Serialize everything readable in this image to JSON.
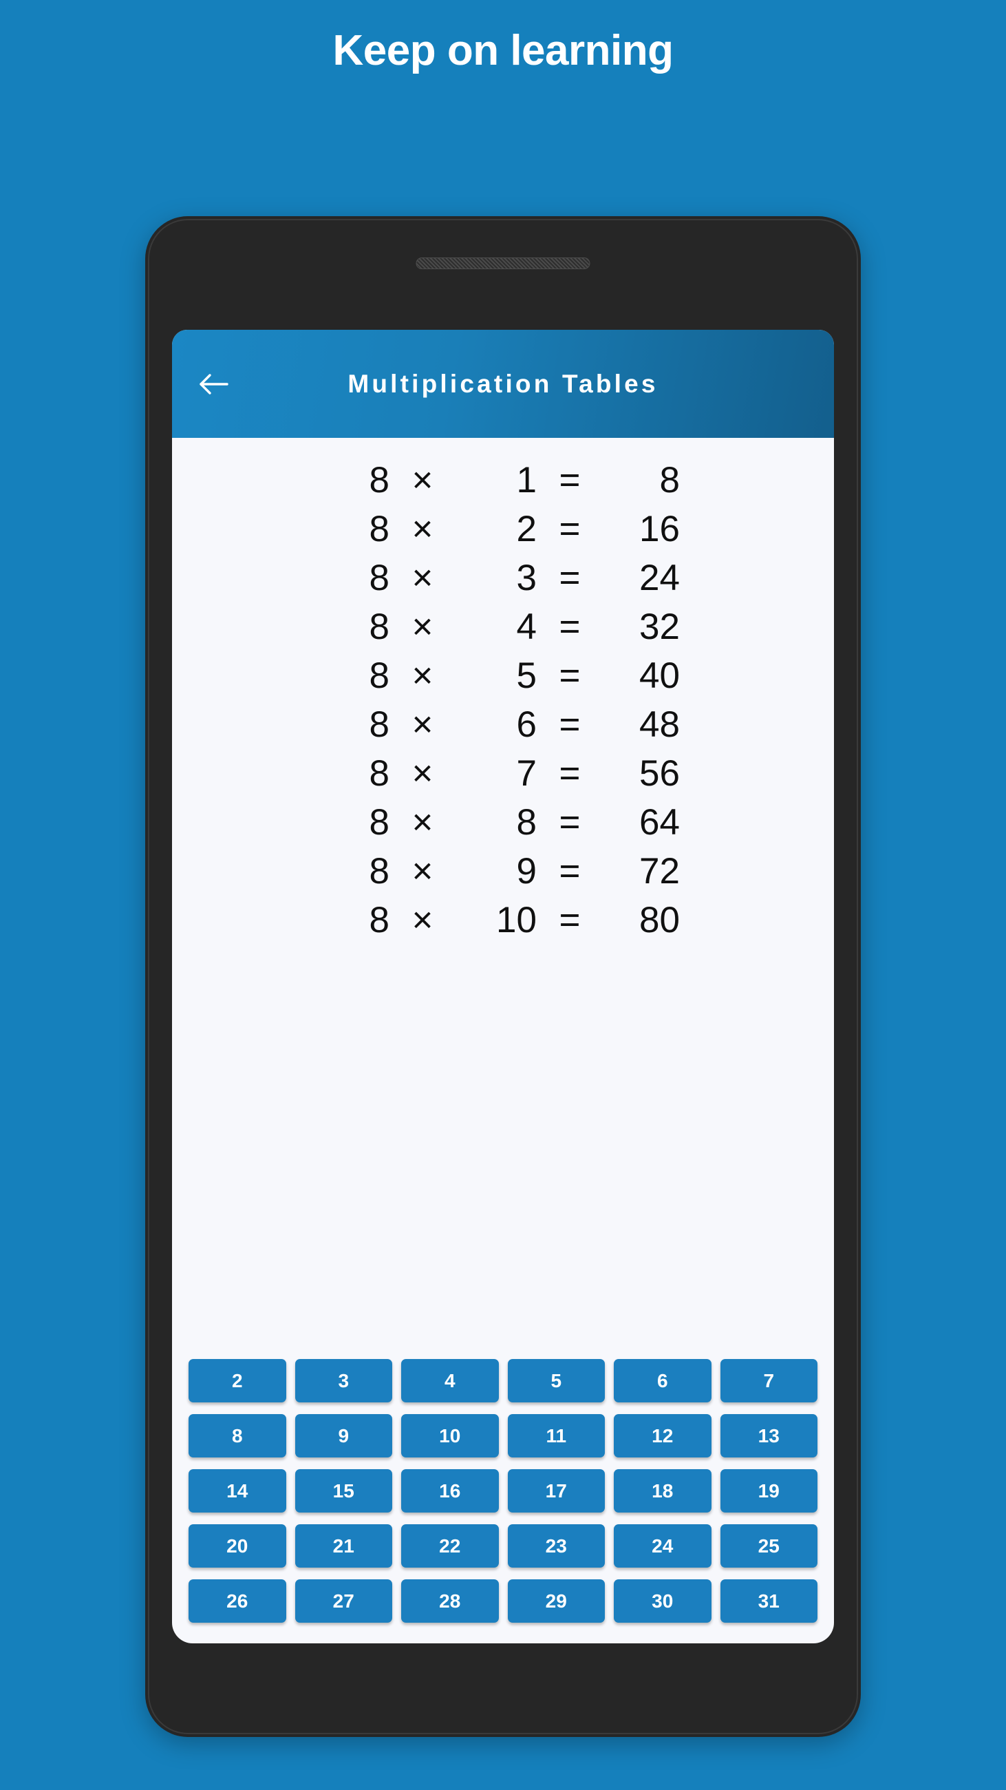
{
  "promo": {
    "headline": "Keep on learning"
  },
  "phone": {
    "earpiece_icon": "speaker-grille-icon"
  },
  "appbar": {
    "back_icon": "arrow-left-icon",
    "title": "Multiplication Tables",
    "gradient_from": "#1b87c4",
    "gradient_to": "#135f8d"
  },
  "table": {
    "multiplicand": "8",
    "operator": "×",
    "equals": "=",
    "rows": [
      {
        "a": "8",
        "op": "×",
        "b": "1",
        "eq": "=",
        "result": "8"
      },
      {
        "a": "8",
        "op": "×",
        "b": "2",
        "eq": "=",
        "result": "16"
      },
      {
        "a": "8",
        "op": "×",
        "b": "3",
        "eq": "=",
        "result": "24"
      },
      {
        "a": "8",
        "op": "×",
        "b": "4",
        "eq": "=",
        "result": "32"
      },
      {
        "a": "8",
        "op": "×",
        "b": "5",
        "eq": "=",
        "result": "40"
      },
      {
        "a": "8",
        "op": "×",
        "b": "6",
        "eq": "=",
        "result": "48"
      },
      {
        "a": "8",
        "op": "×",
        "b": "7",
        "eq": "=",
        "result": "56"
      },
      {
        "a": "8",
        "op": "×",
        "b": "8",
        "eq": "=",
        "result": "64"
      },
      {
        "a": "8",
        "op": "×",
        "b": "9",
        "eq": "=",
        "result": "72"
      },
      {
        "a": "8",
        "op": "×",
        "b": "10",
        "eq": "=",
        "result": "80"
      }
    ]
  },
  "numpad": {
    "button_color": "#1b7fbf",
    "rows": [
      [
        "2",
        "3",
        "4",
        "5",
        "6",
        "7"
      ],
      [
        "8",
        "9",
        "10",
        "11",
        "12",
        "13"
      ],
      [
        "14",
        "15",
        "16",
        "17",
        "18",
        "19"
      ],
      [
        "20",
        "21",
        "22",
        "23",
        "24",
        "25"
      ],
      [
        "26",
        "27",
        "28",
        "29",
        "30",
        "31"
      ]
    ]
  },
  "theme": {
    "background": "#1580bc",
    "screen_background": "#f7f8fc",
    "frame": "#262626",
    "text_dark": "#101010",
    "text_light": "#ffffff"
  }
}
